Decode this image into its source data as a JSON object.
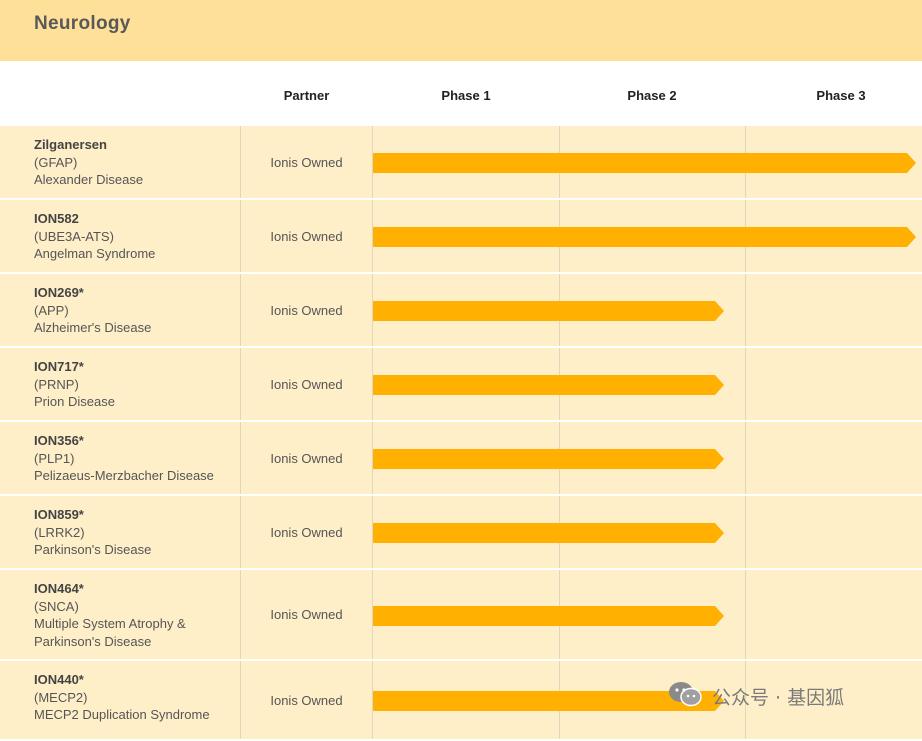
{
  "section": {
    "title": "Neurology"
  },
  "columns": {
    "partner": "Partner",
    "phase1": "Phase 1",
    "phase2": "Phase 2",
    "phase3": "Phase 3"
  },
  "colors": {
    "bar": "#ffb000",
    "row_bg": "#ffefc9",
    "header_bg": "#ffe099"
  },
  "programs": [
    {
      "name": "Zilganersen",
      "target": "(GFAP)",
      "indication": "Alexander Disease",
      "partner": "Ionis Owned",
      "phase_progress": 3
    },
    {
      "name": "ION582",
      "target": "(UBE3A-ATS)",
      "indication": "Angelman Syndrome",
      "partner": "Ionis Owned",
      "phase_progress": 3
    },
    {
      "name": "ION269*",
      "target": "(APP)",
      "indication": "Alzheimer's Disease",
      "partner": "Ionis Owned",
      "phase_progress": 2
    },
    {
      "name": "ION717*",
      "target": "(PRNP)",
      "indication": "Prion Disease",
      "partner": "Ionis Owned",
      "phase_progress": 2
    },
    {
      "name": "ION356*",
      "target": "(PLP1)",
      "indication": "Pelizaeus-Merzbacher Disease",
      "partner": "Ionis Owned",
      "phase_progress": 2
    },
    {
      "name": "ION859*",
      "target": "(LRRK2)",
      "indication": "Parkinson's Disease",
      "partner": "Ionis Owned",
      "phase_progress": 2
    },
    {
      "name": "ION464*",
      "target": "(SNCA)",
      "indication": "Multiple System Atrophy & Parkinson's Disease",
      "partner": "Ionis Owned",
      "phase_progress": 2
    },
    {
      "name": "ION440*",
      "target": "(MECP2)",
      "indication": "MECP2 Duplication Syndrome",
      "partner": "Ionis Owned",
      "phase_progress": 2
    }
  ],
  "watermark": {
    "icon": "wechat-icon",
    "text": "公众号 · 基因狐"
  }
}
